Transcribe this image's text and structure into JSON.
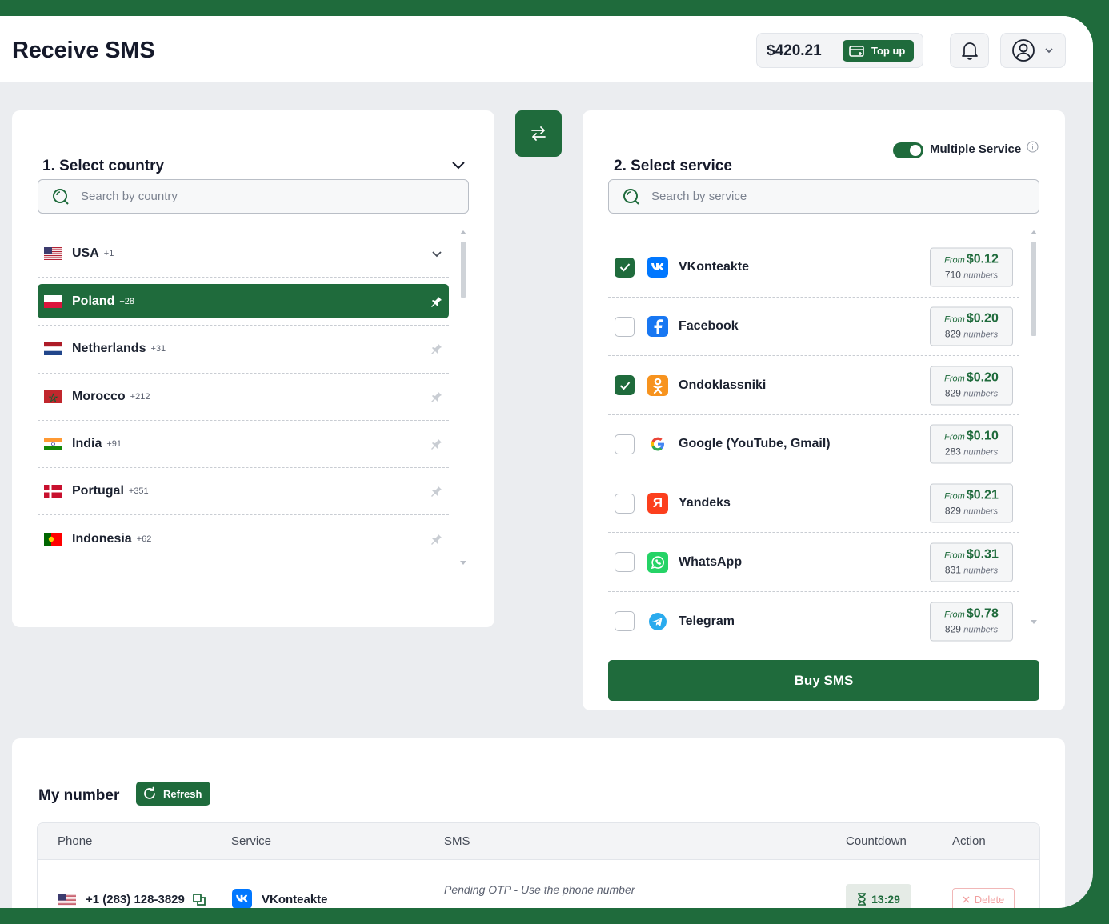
{
  "header": {
    "title": "Receive SMS",
    "balance": "$420.21",
    "topup_label": "Top up"
  },
  "country_panel": {
    "title": "1. Select country",
    "search_placeholder": "Search by country",
    "countries": [
      {
        "name": "USA",
        "code": "+1",
        "selected": false
      },
      {
        "name": "Poland",
        "code": "+28",
        "selected": true
      },
      {
        "name": "Netherlands",
        "code": "+31",
        "selected": false
      },
      {
        "name": "Morocco",
        "code": "+212",
        "selected": false
      },
      {
        "name": "India",
        "code": "+91",
        "selected": false
      },
      {
        "name": "Portugal",
        "code": "+351",
        "selected": false
      },
      {
        "name": "Indonesia",
        "code": "+62",
        "selected": false
      }
    ]
  },
  "service_panel": {
    "title": "2. Select service",
    "toggle_label": "Multiple Service",
    "toggle_on": true,
    "search_placeholder": "Search by service",
    "price_prefix": "From",
    "numbers_suffix": "numbers",
    "services": [
      {
        "name": "VKonteakte",
        "price": "$0.12",
        "numbers": "710",
        "checked": true,
        "icon": "vk-icon",
        "color": "#0077ff"
      },
      {
        "name": "Facebook",
        "price": "$0.20",
        "numbers": "829",
        "checked": false,
        "icon": "facebook-icon",
        "color": "#1877f2"
      },
      {
        "name": "Ondoklassniki",
        "price": "$0.20",
        "numbers": "829",
        "checked": true,
        "icon": "odnoklassniki-icon",
        "color": "#f7931e"
      },
      {
        "name": "Google (YouTube, Gmail)",
        "price": "$0.10",
        "numbers": "283",
        "checked": false,
        "icon": "google-icon",
        "color": "#ffffff"
      },
      {
        "name": "Yandeks",
        "price": "$0.21",
        "numbers": "829",
        "checked": false,
        "icon": "yandex-icon",
        "color": "#fc3f1d"
      },
      {
        "name": "WhatsApp",
        "price": "$0.31",
        "numbers": "831",
        "checked": false,
        "icon": "whatsapp-icon",
        "color": "#25d366"
      },
      {
        "name": "Telegram",
        "price": "$0.78",
        "numbers": "829",
        "checked": false,
        "icon": "telegram-icon",
        "color": "#2aabee"
      }
    ],
    "buy_label": "Buy SMS"
  },
  "my_number": {
    "title": "My number",
    "refresh_label": "Refresh",
    "columns": [
      "Phone",
      "Service",
      "SMS",
      "Countdown",
      "Action"
    ],
    "rows": [
      {
        "phone": "+1 (283) 128-3829",
        "service": "VKonteakte",
        "sms": "Pending OTP - Use the phone number",
        "countdown": "13:29",
        "action": "Delete"
      }
    ]
  },
  "colors": {
    "brand": "#1f6b3c",
    "page_bg": "#ebedf0",
    "danger": "#f1a0a0"
  }
}
